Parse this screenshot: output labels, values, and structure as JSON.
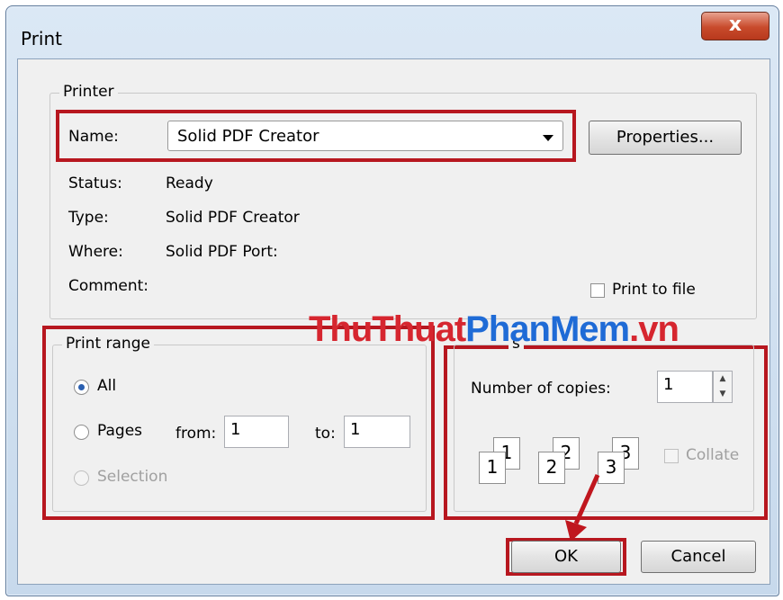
{
  "window": {
    "title": "Print",
    "close_glyph": "x"
  },
  "printer": {
    "legend": "Printer",
    "name_label": "Name:",
    "name_value": "Solid PDF Creator",
    "properties_button": "Properties...",
    "status_label": "Status:",
    "status_value": "Ready",
    "type_label": "Type:",
    "type_value": "Solid PDF Creator",
    "where_label": "Where:",
    "where_value": "Solid PDF Port:",
    "comment_label": "Comment:",
    "print_to_file": "Print to file"
  },
  "range": {
    "legend": "Print range",
    "all": "All",
    "pages": "Pages",
    "from_label": "from:",
    "from_value": "1",
    "to_label": "to:",
    "to_value": "1",
    "selection": "Selection",
    "selected": "All"
  },
  "copies": {
    "legend_fragment": "s",
    "number_label": "Number of copies:",
    "number_value": "1",
    "collate": "Collate",
    "page_digits": [
      "1",
      "1",
      "2",
      "2",
      "3",
      "3"
    ]
  },
  "buttons": {
    "ok": "OK",
    "cancel": "Cancel"
  },
  "watermark": {
    "part1": "ThuThuat",
    "part2": "PhanMem",
    "part3": ".vn"
  },
  "colors": {
    "highlight": "#b7171f",
    "watermark_red": "#d6262f",
    "watermark_blue": "#1f6bd6"
  }
}
